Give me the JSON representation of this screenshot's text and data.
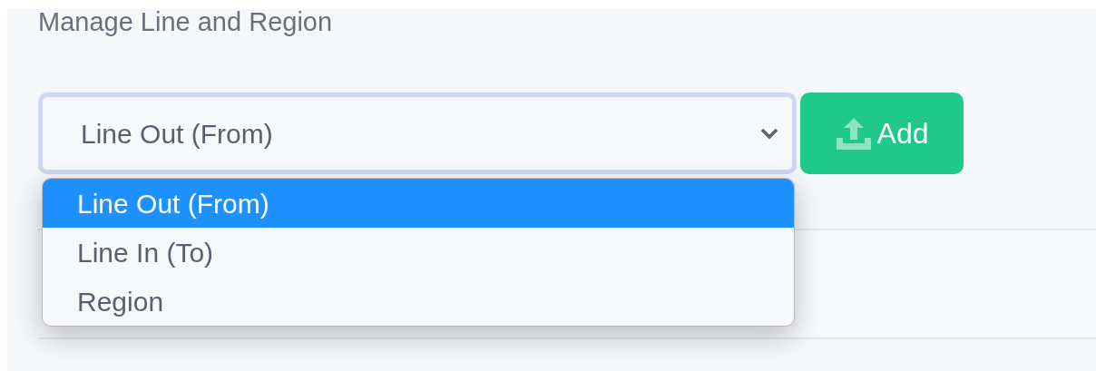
{
  "heading": "Manage Line and Region",
  "select": {
    "value": "Line Out (From)",
    "expanded": true
  },
  "options": [
    {
      "label": "Line Out (From)",
      "selected": true
    },
    {
      "label": "Line In (To)",
      "selected": false
    },
    {
      "label": "Region",
      "selected": false
    }
  ],
  "add_button": {
    "label": "Add"
  }
}
